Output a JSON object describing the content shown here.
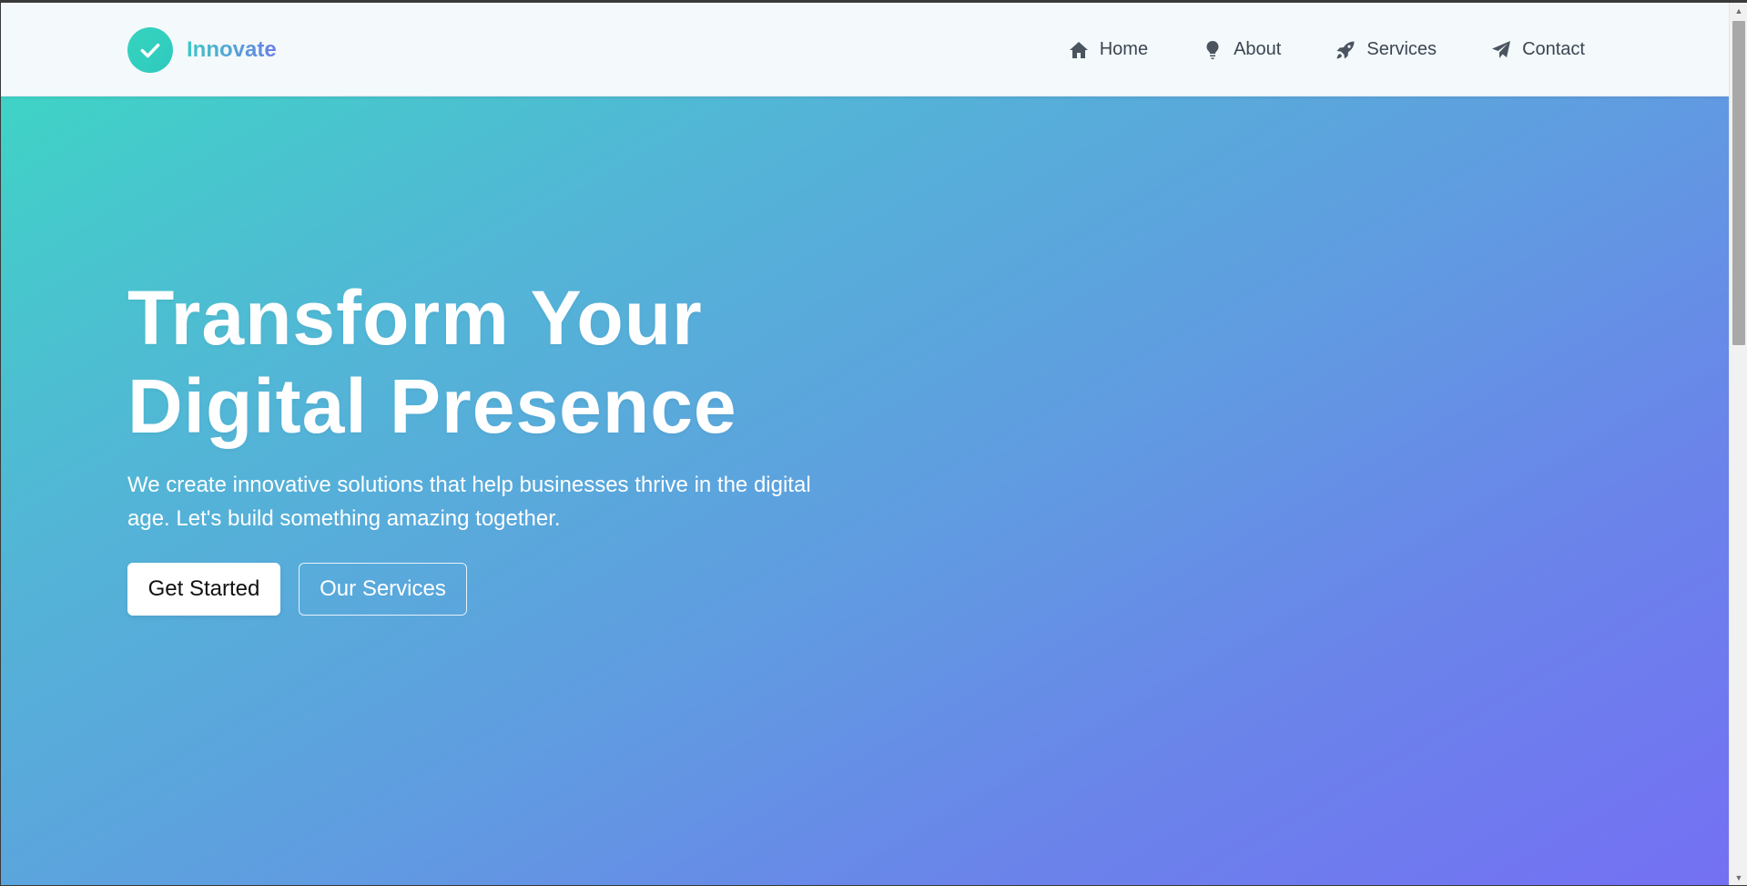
{
  "brand": {
    "name": "Innovate",
    "logo_icon": "check-circle-icon",
    "accent_color": "#35d4be"
  },
  "nav": {
    "items": [
      {
        "label": "Home",
        "icon": "home-icon"
      },
      {
        "label": "About",
        "icon": "lightbulb-icon"
      },
      {
        "label": "Services",
        "icon": "rocket-icon"
      },
      {
        "label": "Contact",
        "icon": "paper-plane-icon"
      }
    ]
  },
  "hero": {
    "title_line1": "Transform Your",
    "title_line2": "Digital Presence",
    "subtitle": "We create innovative solutions that help businesses thrive in the digital age. Let's build something amazing together.",
    "primary_button": "Get Started",
    "secondary_button": "Our Services",
    "gradient_start": "#3fd3c6",
    "gradient_end": "#7470f3"
  }
}
